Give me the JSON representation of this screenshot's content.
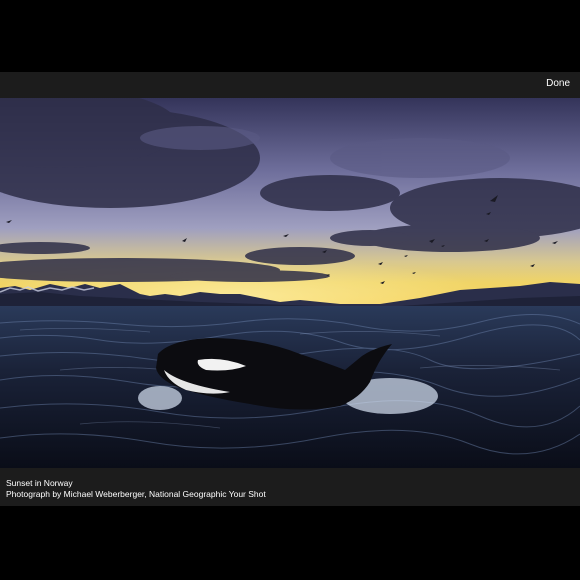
{
  "toolbar": {
    "done_label": "Done"
  },
  "photo": {
    "caption_title": "Sunset in Norway",
    "caption_credit": "Photograph by Michael Weberberger, National Geographic Your Shot"
  },
  "colors": {
    "bar_background": "#1c1c1c",
    "page_background": "#000000",
    "text": "#ffffff"
  }
}
